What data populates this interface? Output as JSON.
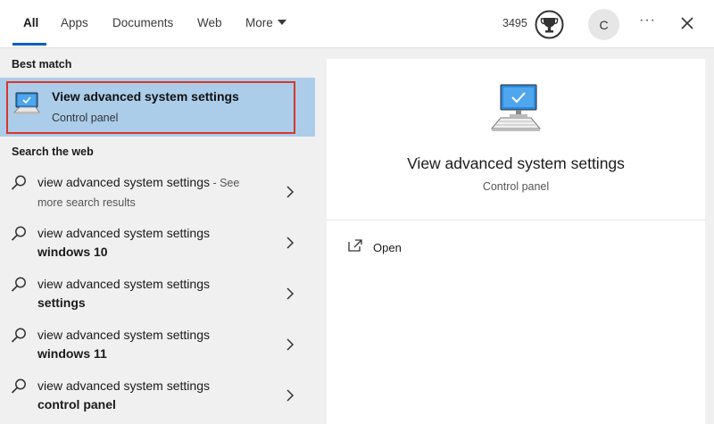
{
  "tabs": [
    {
      "label": "All",
      "active": true
    },
    {
      "label": "Apps"
    },
    {
      "label": "Documents"
    },
    {
      "label": "Web"
    },
    {
      "label": "More"
    }
  ],
  "header": {
    "points": "3495",
    "avatar_initial": "C",
    "more_icon": "ellipsis-icon",
    "close_icon": "close-icon",
    "trophy_icon": "trophy-icon"
  },
  "best_match": {
    "heading": "Best match",
    "title": "View advanced system settings",
    "subtitle": "Control panel",
    "icon": "monitor-check-icon"
  },
  "web": {
    "heading": "Search the web",
    "items": [
      {
        "text": "view advanced system settings",
        "see": " - See",
        "line2": "more search results"
      },
      {
        "text": "view advanced system settings",
        "line2": "windows 10"
      },
      {
        "text": "view advanced system settings",
        "line2": "settings"
      },
      {
        "text": "view advanced system settings",
        "line2": "windows 11"
      },
      {
        "text": "view advanced system settings",
        "line2": "control panel"
      }
    ]
  },
  "detail": {
    "title": "View advanced system settings",
    "subtitle": "Control panel",
    "open_label": "Open"
  },
  "colors": {
    "accent": "#0b5ec2",
    "highlight": "#abcde9",
    "outline": "#d9362b"
  }
}
